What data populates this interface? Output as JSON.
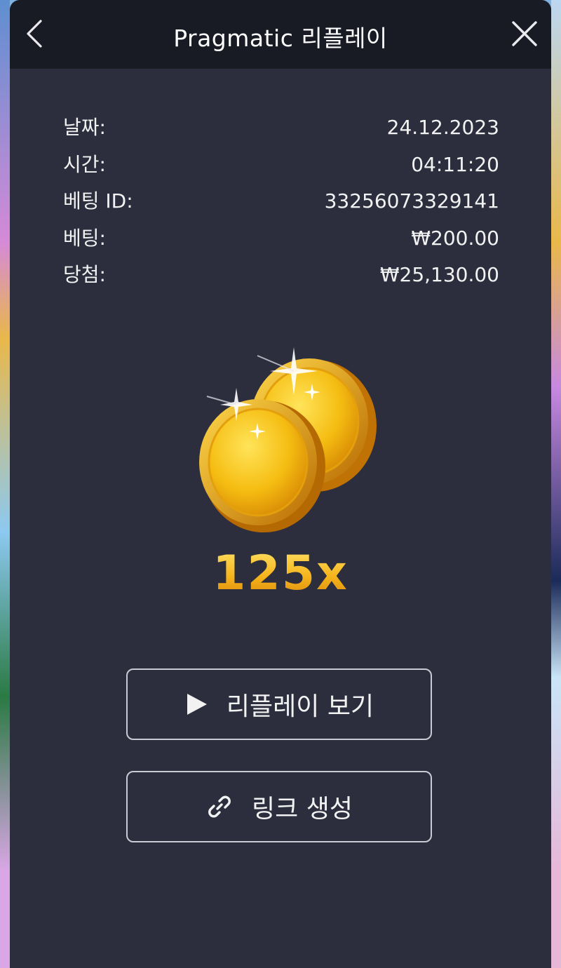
{
  "header": {
    "title": "Pragmatic 리플레이",
    "back_icon": "chevron-left-icon",
    "close_icon": "close-icon"
  },
  "details": [
    {
      "label": "날짜:",
      "value": "24.12.2023"
    },
    {
      "label": "시간:",
      "value": "04:11:20"
    },
    {
      "label": "베팅 ID:",
      "value": "33256073329141"
    },
    {
      "label": "베팅:",
      "value": "₩200.00"
    },
    {
      "label": "당첨:",
      "value": "₩25,130.00"
    }
  ],
  "result": {
    "multiplier": "125x",
    "icon": "gold-coins-icon"
  },
  "buttons": {
    "replay_label": "리플레이 보기",
    "replay_icon": "play-icon",
    "link_label": "링크 생성",
    "link_icon": "link-icon"
  },
  "colors": {
    "modal_bg": "#2c2e3d",
    "header_bg": "#181a24",
    "accent_gold": "#f6b51c"
  }
}
